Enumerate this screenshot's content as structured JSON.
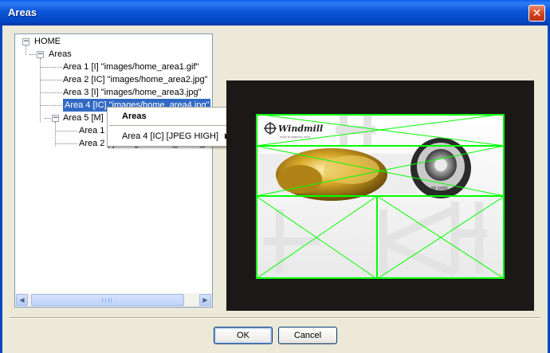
{
  "window": {
    "title": "Areas",
    "close_label": "✕"
  },
  "tree": {
    "root": {
      "label": "HOME",
      "expander": "−"
    },
    "areas": {
      "label": "Areas",
      "expander": "−"
    },
    "items": [
      {
        "label": "Area 1 [I] \"images/home_area1.gif\""
      },
      {
        "label": "Area 2 [IC] \"images/home_area2.jpg\""
      },
      {
        "label": "Area 3 [I] \"images/home_area3.jpg\""
      },
      {
        "label": "Area 4 [IC] \"images/home_area4.jpg\"",
        "selected": true
      },
      {
        "label": "Area 5 [M]",
        "expander": "−"
      },
      {
        "label": "Area 1"
      },
      {
        "label": "Area 2 [I] \"images/home_area5_a\""
      }
    ]
  },
  "context_menu": {
    "header": "Areas",
    "items": [
      {
        "label": "Area 4 [IC] [JPEG HIGH]",
        "has_submenu": true
      }
    ]
  },
  "preview": {
    "logo_text": "Windmill",
    "logo_tagline": "MADE IN WINDMILL TECH",
    "dial_label": "SP-1000",
    "frame_color": "#1B1817",
    "area_outline_color": "#00FF00"
  },
  "buttons": {
    "ok": "OK",
    "cancel": "Cancel"
  }
}
